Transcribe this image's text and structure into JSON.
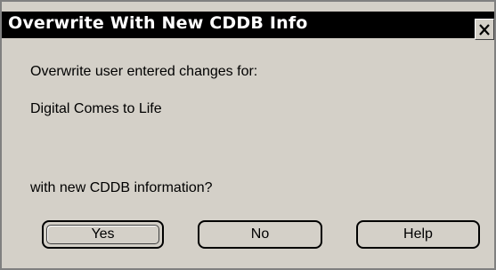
{
  "window": {
    "title": "Overwrite With New CDDB Info",
    "close_label": "Close"
  },
  "message": {
    "line1": "Overwrite user entered changes for:",
    "album": "Digital Comes to Life",
    "line3": "with new CDDB information?"
  },
  "buttons": {
    "yes": "Yes",
    "no": "No",
    "help": "Help"
  },
  "colors": {
    "titlebar": "#000000",
    "face": "#d4d0c8"
  }
}
